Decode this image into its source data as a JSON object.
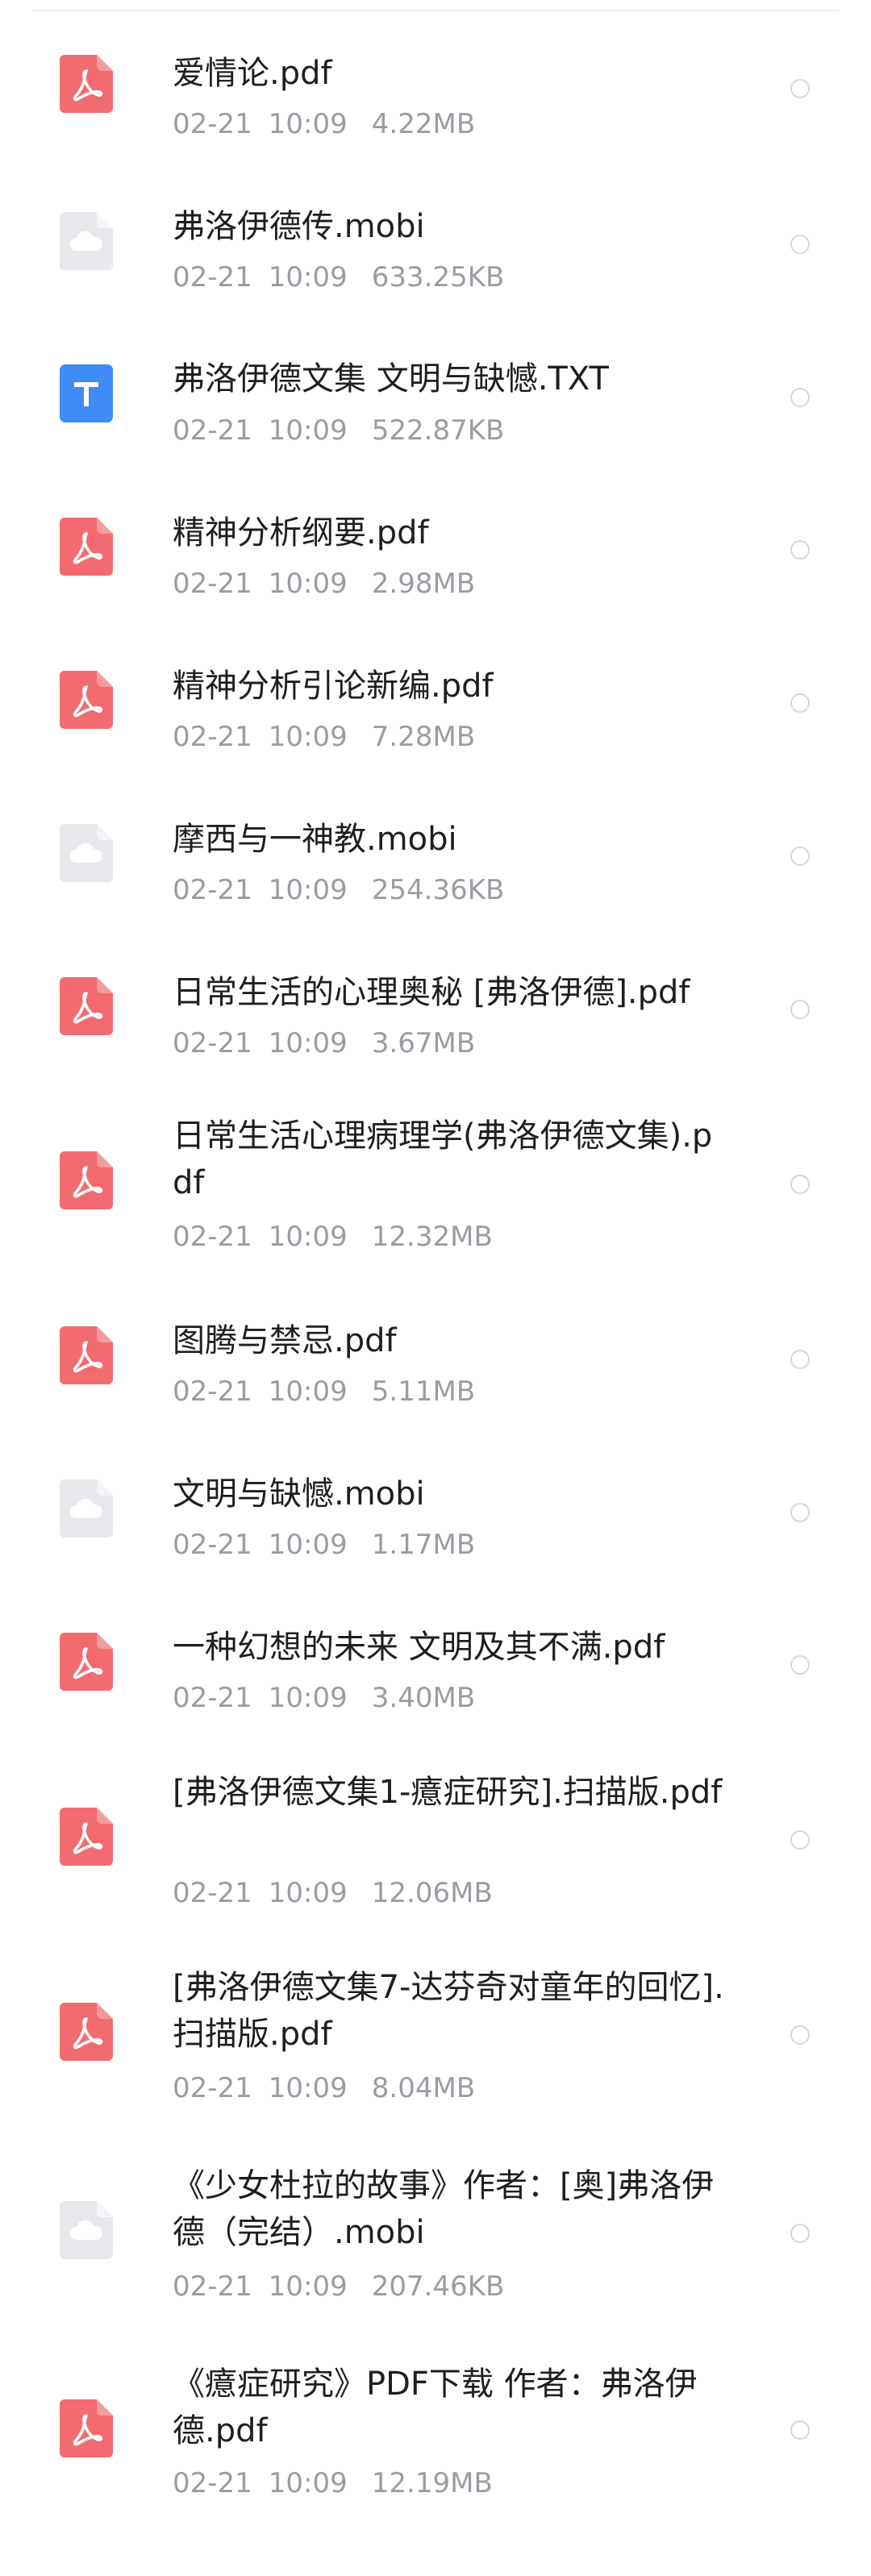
{
  "files": [
    {
      "name": "爱情论.pdf",
      "date": "02-21",
      "time": "10:09",
      "size": "4.22MB",
      "type": "pdf",
      "icon": "pdf-icon"
    },
    {
      "name": "弗洛伊德传.mobi",
      "date": "02-21",
      "time": "10:09",
      "size": "633.25KB",
      "type": "mobi",
      "icon": "cloud-file-icon"
    },
    {
      "name": "弗洛伊德文集 文明与缺憾.TXT",
      "date": "02-21",
      "time": "10:09",
      "size": "522.87KB",
      "type": "txt",
      "icon": "text-file-icon"
    },
    {
      "name": "精神分析纲要.pdf",
      "date": "02-21",
      "time": "10:09",
      "size": "2.98MB",
      "type": "pdf",
      "icon": "pdf-icon"
    },
    {
      "name": "精神分析引论新编.pdf",
      "date": "02-21",
      "time": "10:09",
      "size": "7.28MB",
      "type": "pdf",
      "icon": "pdf-icon"
    },
    {
      "name": "摩西与一神教.mobi",
      "date": "02-21",
      "time": "10:09",
      "size": "254.36KB",
      "type": "mobi",
      "icon": "cloud-file-icon"
    },
    {
      "name": "日常生活的心理奥秘 [弗洛伊德].pdf",
      "date": "02-21",
      "time": "10:09",
      "size": "3.67MB",
      "type": "pdf",
      "icon": "pdf-icon"
    },
    {
      "name": "日常生活心理病理学(弗洛伊德文集).pdf",
      "date": "02-21",
      "time": "10:09",
      "size": "12.32MB",
      "type": "pdf",
      "icon": "pdf-icon"
    },
    {
      "name": "图腾与禁忌.pdf",
      "date": "02-21",
      "time": "10:09",
      "size": "5.11MB",
      "type": "pdf",
      "icon": "pdf-icon"
    },
    {
      "name": "文明与缺憾.mobi",
      "date": "02-21",
      "time": "10:09",
      "size": "1.17MB",
      "type": "mobi",
      "icon": "cloud-file-icon"
    },
    {
      "name": "一种幻想的未来 文明及其不满.pdf",
      "date": "02-21",
      "time": "10:09",
      "size": "3.40MB",
      "type": "pdf",
      "icon": "pdf-icon"
    },
    {
      "name": "[弗洛伊德文集1-癔症研究].扫描版.pdf",
      "date": "02-21",
      "time": "10:09",
      "size": "12.06MB",
      "type": "pdf",
      "icon": "pdf-icon"
    },
    {
      "name": "[弗洛伊德文集7-达芬奇对童年的回忆].扫描版.pdf",
      "date": "02-21",
      "time": "10:09",
      "size": "8.04MB",
      "type": "pdf",
      "icon": "pdf-icon"
    },
    {
      "name": "《少女杜拉的故事》作者：[奥]弗洛伊德（完结）.mobi",
      "date": "02-21",
      "time": "10:09",
      "size": "207.46KB",
      "type": "mobi",
      "icon": "cloud-file-icon"
    },
    {
      "name": "《癔症研究》PDF下载 作者：弗洛伊德.pdf",
      "date": "02-21",
      "time": "10:09",
      "size": "12.19MB",
      "type": "pdf",
      "icon": "pdf-icon"
    }
  ],
  "colors": {
    "pdf_icon": "#f26b6f",
    "cloud_icon": "#e7e8ec",
    "txt_icon": "#3f8cf4",
    "name_text": "#1f1f1f",
    "meta_text": "#9a9ca3",
    "radio_border": "#d6d7db"
  }
}
